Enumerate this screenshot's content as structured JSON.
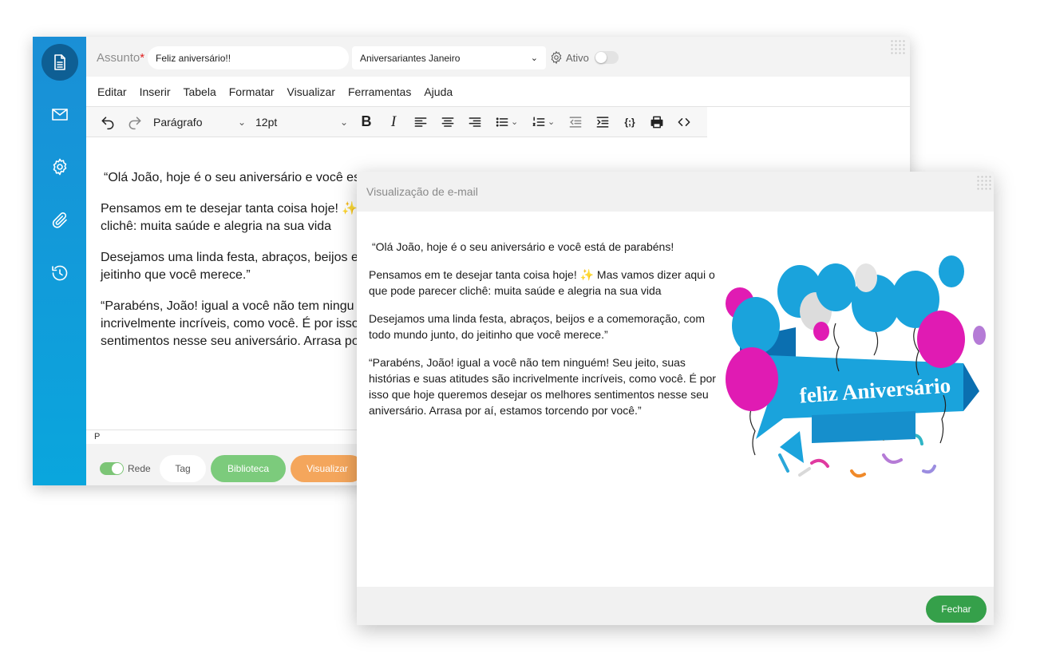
{
  "sidebar": {
    "items": [
      {
        "icon": "document-icon",
        "active": true
      },
      {
        "icon": "envelope-icon"
      },
      {
        "icon": "gear-icon"
      },
      {
        "icon": "paperclip-icon"
      },
      {
        "icon": "history-icon"
      }
    ]
  },
  "subject": {
    "label": "Assunto",
    "required_mark": "*",
    "value": "Feliz aniversário!!"
  },
  "list_select": {
    "value": "Aniversariantes Janeiro"
  },
  "active_toggle": {
    "label": "Ativo",
    "on": false
  },
  "menubar": [
    "Editar",
    "Inserir",
    "Tabela",
    "Formatar",
    "Visualizar",
    "Ferramentas",
    "Ajuda"
  ],
  "toolbar": {
    "block_format": "Parágrafo",
    "font_size": "12pt"
  },
  "editor": {
    "paragraphs": [
      " “Olá João, hoje é o seu aniversário e você es",
      "Pensamos em te desejar tanta coisa hoje! ✨",
      "clichê: muita saúde e alegria na sua vida",
      "Desejamos uma linda festa, abraços, beijos e",
      "jeitinho que você merece.”",
      "“Parabéns, João! igual a você não tem ningu",
      "incrivelmente incríveis, como você. É por isso",
      "sentimentos nesse seu aniversário. Arrasa po"
    ],
    "status_path": "P"
  },
  "bottombar": {
    "network_toggle": {
      "label": "Rede",
      "on": true
    },
    "tag_label": "Tag",
    "library_label": "Biblioteca",
    "preview_label": "Visualizar"
  },
  "preview": {
    "title": "Visualização de e-mail",
    "paragraphs": [
      " “Olá João, hoje é o seu aniversário e você está de parabéns!",
      "Pensamos em te desejar tanta coisa hoje! ✨ Mas vamos dizer aqui o que pode parecer clichê: muita saúde e alegria na sua vida",
      "Desejamos uma linda festa, abraços, beijos e a comemoração, com todo mundo junto, do jeitinho que você merece.”",
      "“Parabéns, João! igual a você não tem ninguém! Seu jeito, suas histórias e suas atitudes são incrivelmente incríveis, como você. É por isso que hoje queremos desejar os melhores sentimentos nesse seu aniversário. Arrasa por aí, estamos torcendo por você.”"
    ],
    "card_text": "feliz Aniversário",
    "close_label": "Fechar"
  },
  "colors": {
    "sidebar": "#1a8fd6",
    "library": "#7ccb7c",
    "preview": "#f4a65c",
    "close": "#35a04a",
    "balloon_blue": "#1aa3dc",
    "balloon_pink": "#e01bb3"
  }
}
